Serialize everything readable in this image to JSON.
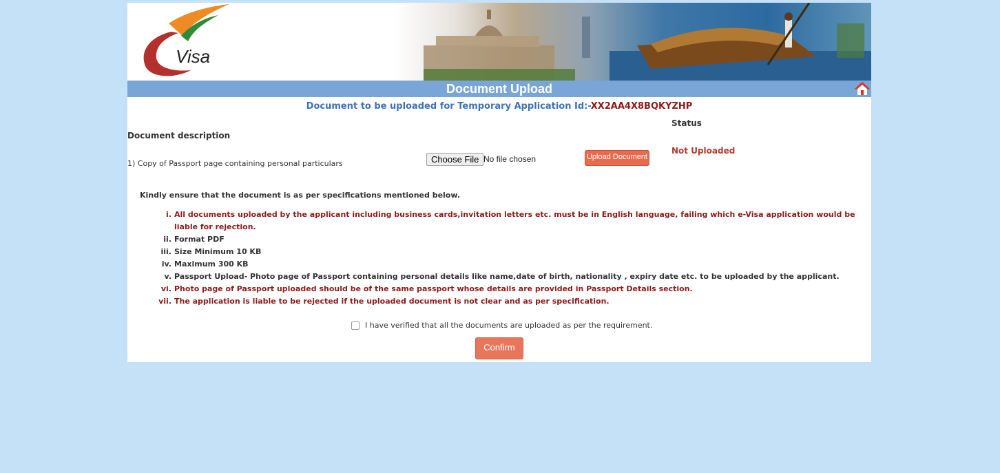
{
  "header": {
    "logo_text": "Visa",
    "title": "Document Upload"
  },
  "application": {
    "prefix": "Document to be uploaded for Temporary Application Id:-",
    "id": "XX2AA4X8BQKYZHP"
  },
  "table": {
    "desc_header": "Document description",
    "status_header": "Status",
    "rows": [
      {
        "label": "1) Copy of Passport page containing personal particulars",
        "choose_label": "Choose File",
        "file_status": "No file chosen",
        "upload_label": "Upload Document",
        "status": "Not Uploaded"
      }
    ]
  },
  "specs": {
    "intro": "Kindly ensure that the document is as per specifications mentioned below.",
    "items": [
      {
        "num": "i.",
        "text": "All documents uploaded by the applicant including business cards,invitation letters etc. must be in English language, failing which e-Visa application would be liable for rejection."
      },
      {
        "num": "ii.",
        "text": "Format PDF"
      },
      {
        "num": "iii.",
        "text": "Size Minimum 10 KB"
      },
      {
        "num": "iv.",
        "text": "Maximum 300 KB"
      },
      {
        "num": "v.",
        "text": "Passport Upload- Photo page of Passport containing personal details like name,date of birth, nationality , expiry date etc. to be uploaded by the applicant."
      },
      {
        "num": "vi.",
        "text": "Photo page of Passport uploaded should be of the same passport whose details are provided in Passport Details section."
      },
      {
        "num": "vii.",
        "text": "The application is liable to be rejected if the uploaded document is not clear and as per specification."
      }
    ]
  },
  "verify_text": "I have verified that all the documents are uploaded as per the requirement.",
  "confirm_label": "Confirm",
  "colors": {
    "background": "#c5e1f8",
    "title_bar": "#79a6d6",
    "accent_button": "#e86b4e",
    "dark_red_text": "#8b1a1a"
  }
}
